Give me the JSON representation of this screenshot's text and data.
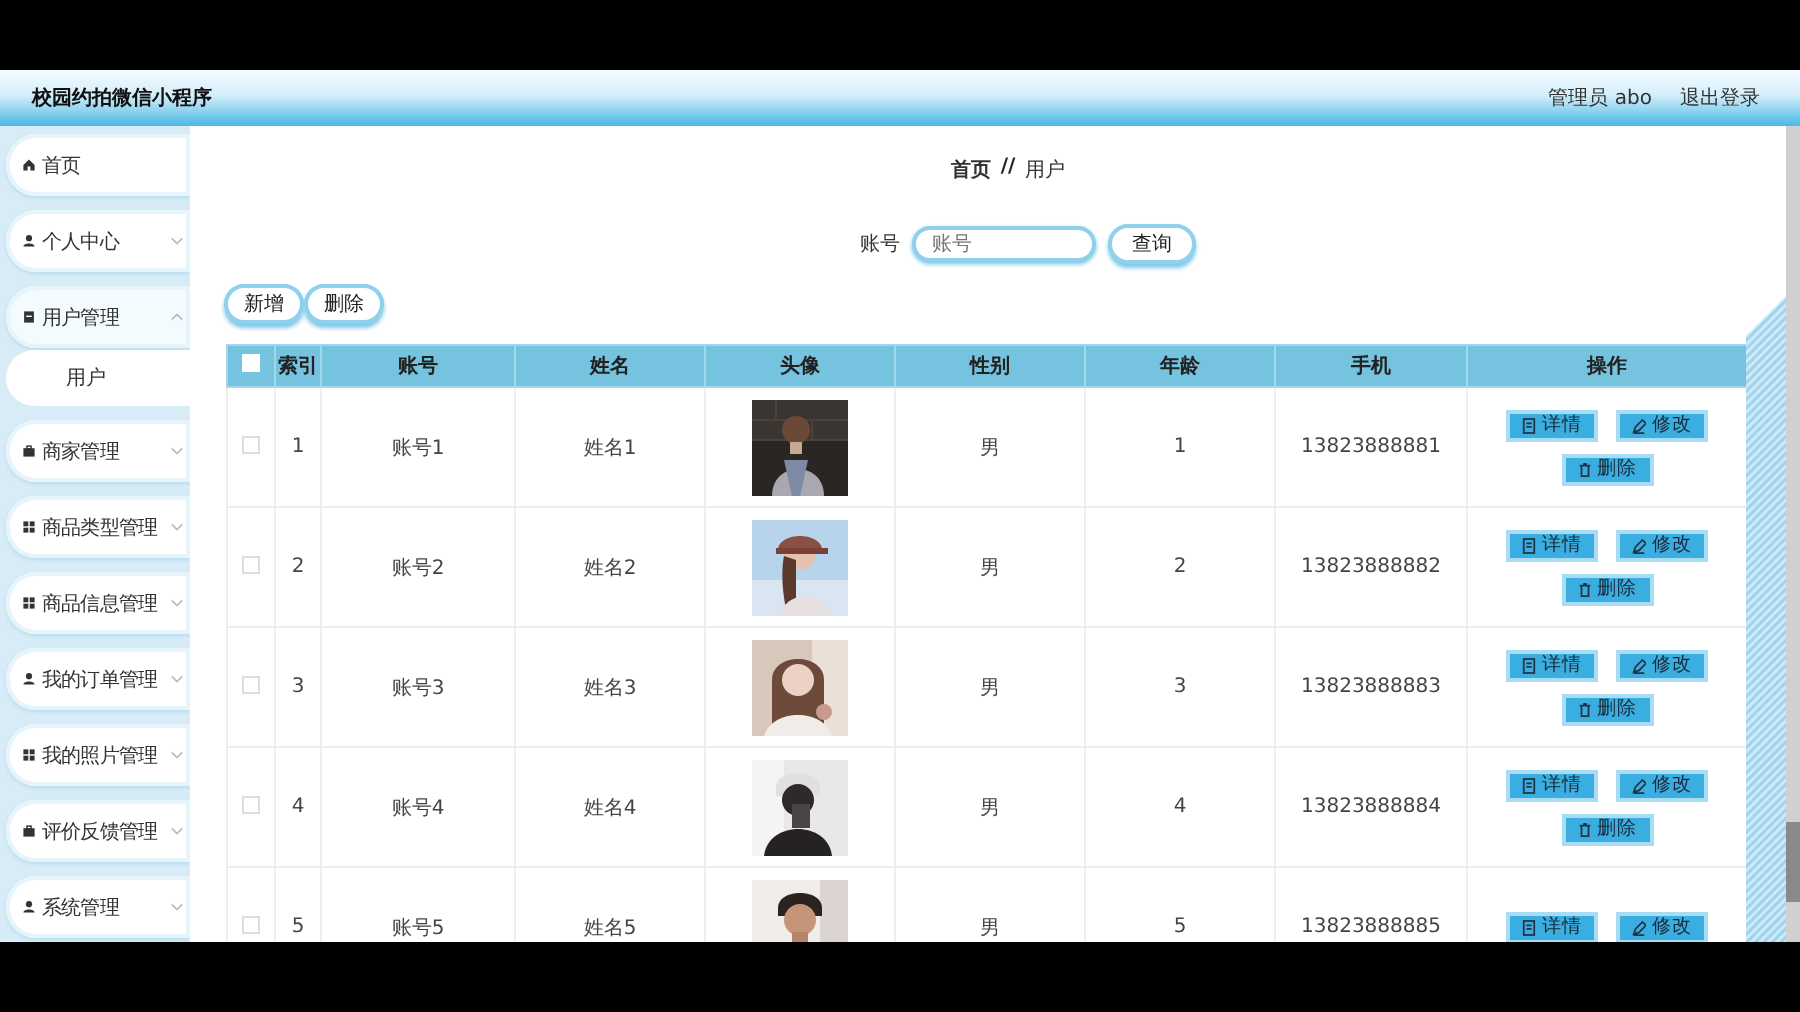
{
  "app_title": "校园约拍微信小程序",
  "header_links": [
    {
      "label": "管理员 abo"
    },
    {
      "label": "退出登录"
    }
  ],
  "sidebar": {
    "items": [
      {
        "label": "首页"
      },
      {
        "label": "个人中心",
        "expanded": false
      },
      {
        "label": "用户管理",
        "expanded": true,
        "children": [
          {
            "label": "用户"
          }
        ]
      },
      {
        "label": "商家管理",
        "expanded": false
      },
      {
        "label": "商品类型管理",
        "expanded": false
      },
      {
        "label": "商品信息管理",
        "expanded": false
      },
      {
        "label": "我的订单管理",
        "expanded": false
      },
      {
        "label": "我的照片管理",
        "expanded": false
      },
      {
        "label": "评价反馈管理",
        "expanded": false
      },
      {
        "label": "系统管理",
        "expanded": false
      }
    ]
  },
  "breadcrumb": [
    "首页",
    "用户"
  ],
  "breadcrumb_separator": "//",
  "search": {
    "label": "账号",
    "placeholder": "账号",
    "button": "查询"
  },
  "toolbar": [
    {
      "label": "新增"
    },
    {
      "label": "删除"
    }
  ],
  "table": {
    "all_selected": false,
    "columns": [
      "索引",
      "账号",
      "姓名",
      "头像",
      "性别",
      "年龄",
      "手机",
      "操作"
    ],
    "rows": [
      {
        "selected": false,
        "index": "1",
        "account": "账号1",
        "name": "姓名1",
        "gender": "男",
        "age": "1",
        "phone": "13823888881",
        "actions": [
          {
            "kind": "detail",
            "label": "详情"
          },
          {
            "kind": "edit",
            "label": "修改"
          },
          {
            "kind": "delete",
            "label": "删除"
          }
        ]
      },
      {
        "selected": false,
        "index": "2",
        "account": "账号2",
        "name": "姓名2",
        "gender": "男",
        "age": "2",
        "phone": "13823888882",
        "actions": [
          {
            "kind": "detail",
            "label": "详情"
          },
          {
            "kind": "edit",
            "label": "修改"
          },
          {
            "kind": "delete",
            "label": "删除"
          }
        ]
      },
      {
        "selected": false,
        "index": "3",
        "account": "账号3",
        "name": "姓名3",
        "gender": "男",
        "age": "3",
        "phone": "13823888883",
        "actions": [
          {
            "kind": "detail",
            "label": "详情"
          },
          {
            "kind": "edit",
            "label": "修改"
          },
          {
            "kind": "delete",
            "label": "删除"
          }
        ]
      },
      {
        "selected": false,
        "index": "4",
        "account": "账号4",
        "name": "姓名4",
        "gender": "男",
        "age": "4",
        "phone": "13823888884",
        "actions": [
          {
            "kind": "detail",
            "label": "详情"
          },
          {
            "kind": "edit",
            "label": "修改"
          },
          {
            "kind": "delete",
            "label": "删除"
          }
        ]
      },
      {
        "selected": false,
        "index": "5",
        "account": "账号5",
        "name": "姓名5",
        "gender": "男",
        "age": "5",
        "phone": "13823888885",
        "actions": [
          {
            "kind": "detail",
            "label": "详情"
          },
          {
            "kind": "edit",
            "label": "修改"
          }
        ]
      }
    ]
  }
}
